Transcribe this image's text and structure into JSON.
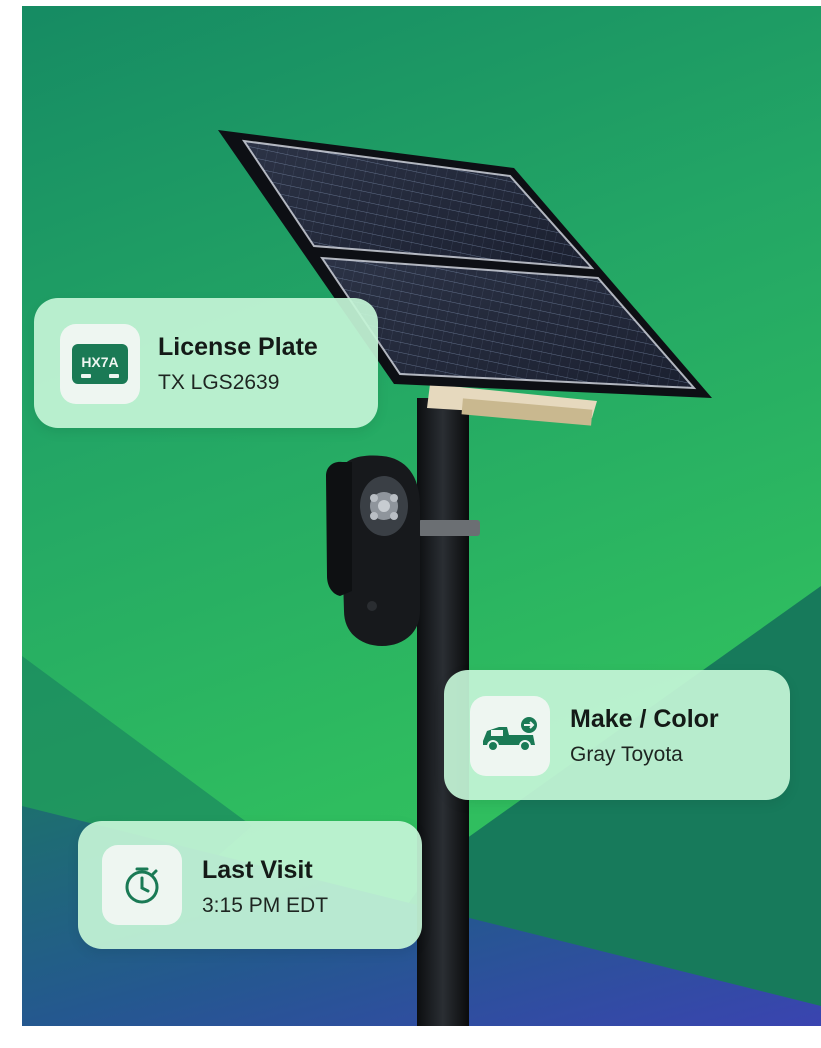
{
  "cards": {
    "license_plate": {
      "title": "License Plate",
      "value": "TX LGS2639",
      "icon": "license-plate-icon",
      "plate_text": "HX7A"
    },
    "make_color": {
      "title": "Make / Color",
      "value": "Gray Toyota",
      "icon": "truck-icon"
    },
    "last_visit": {
      "title": "Last Visit",
      "value": "3:15 PM EDT",
      "icon": "clock-icon"
    }
  },
  "colors": {
    "background_green": "#2fbd5f",
    "background_dark_green": "#168b63",
    "background_blue": "#2f4fa8",
    "card_fill": "#c4f4d6",
    "icon_accent": "#1a7a55"
  },
  "image": {
    "subject": "solar-powered-license-plate-camera-pole"
  }
}
